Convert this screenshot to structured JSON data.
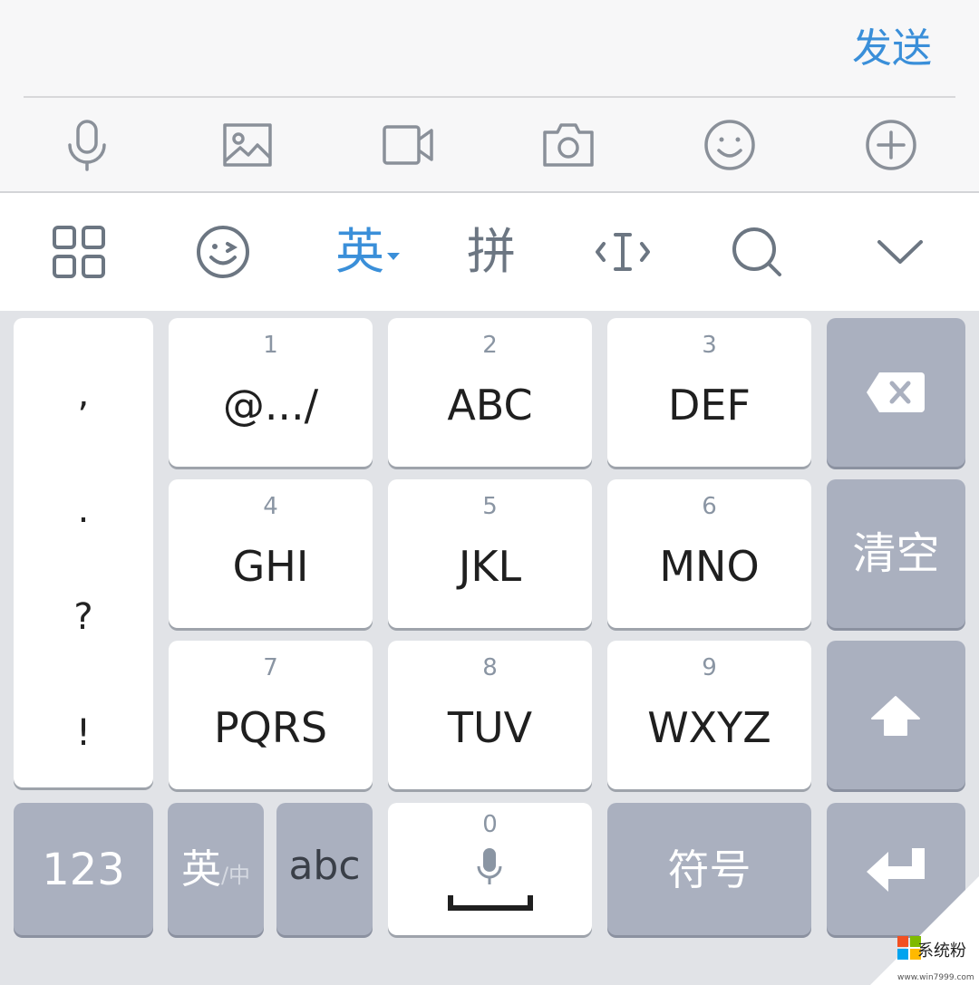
{
  "compose": {
    "send_label": "发送"
  },
  "toolbar": {
    "icons": [
      "microphone-icon",
      "image-icon",
      "video-icon",
      "camera-icon",
      "emoji-icon",
      "plus-icon"
    ]
  },
  "ime_bar": {
    "english_label": "英",
    "pinyin_label": "拼",
    "accent": "#3a8fd9"
  },
  "keyboard": {
    "punctuation": [
      ",",
      ".",
      "?",
      "!"
    ],
    "keys": [
      {
        "num": "1",
        "label": "@.../"
      },
      {
        "num": "2",
        "label": "ABC"
      },
      {
        "num": "3",
        "label": "DEF"
      },
      {
        "num": "4",
        "label": "GHI"
      },
      {
        "num": "5",
        "label": "JKL"
      },
      {
        "num": "6",
        "label": "MNO"
      },
      {
        "num": "7",
        "label": "PQRS"
      },
      {
        "num": "8",
        "label": "TUV"
      },
      {
        "num": "9",
        "label": "WXYZ"
      }
    ],
    "clear_label": "清空",
    "numbers_label": "123",
    "lang_main": "英",
    "lang_sub": "/中",
    "abc_label": "abc",
    "zero_num": "0",
    "symbols_label": "符号"
  },
  "watermark": {
    "site_name": "系统粉",
    "site_url": "www.win7999.com"
  }
}
